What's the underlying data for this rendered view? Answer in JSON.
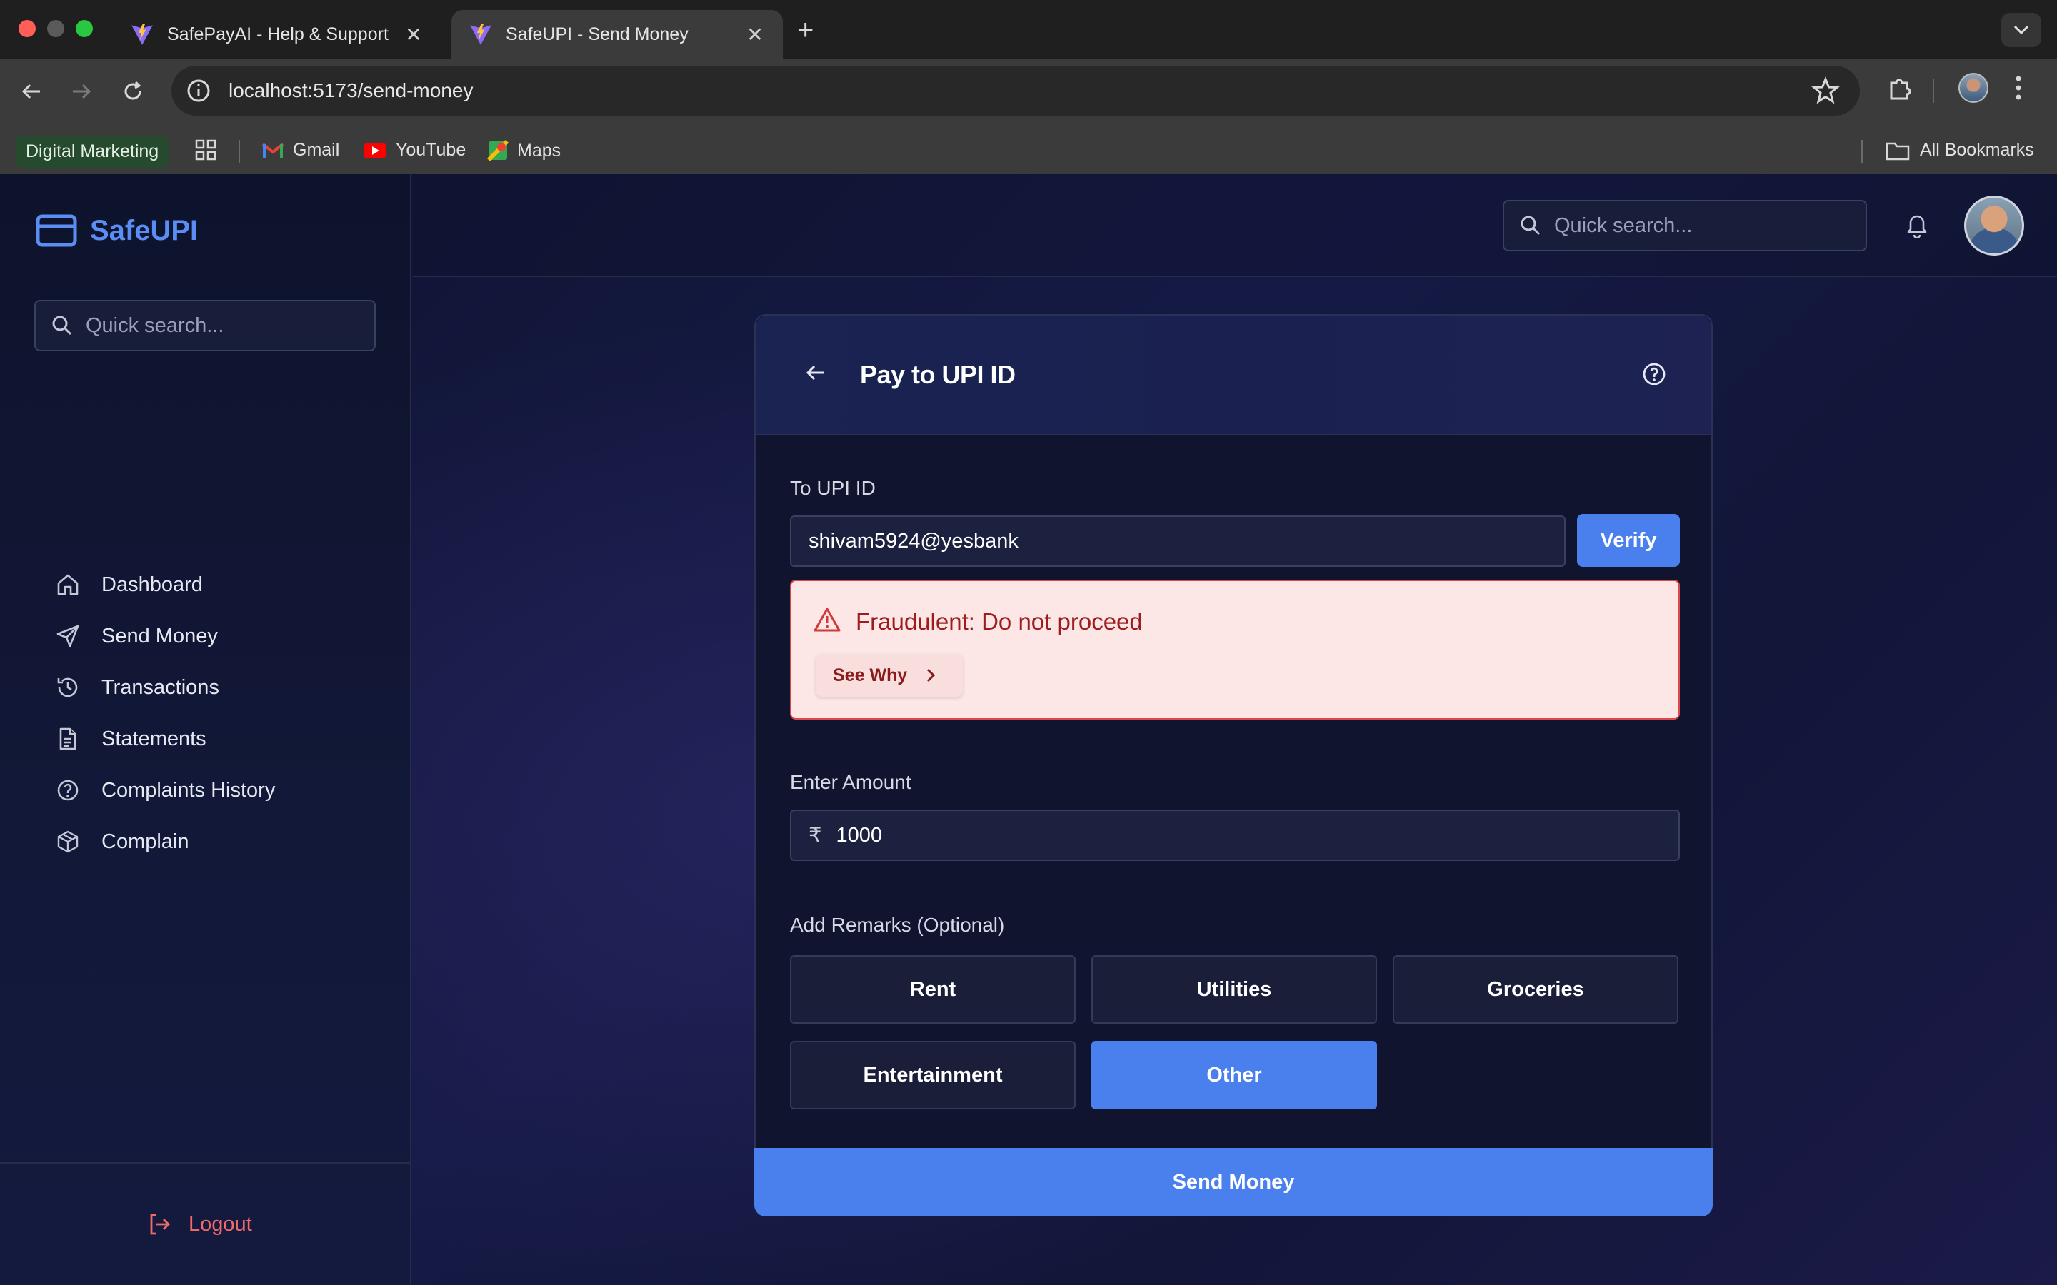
{
  "browser": {
    "tabs": [
      {
        "title": "SafePayAI - Help & Support",
        "active": false
      },
      {
        "title": "SafeUPI - Send Money",
        "active": true
      }
    ],
    "url": "localhost:5173/send-money",
    "bookmarks": {
      "chip": "Digital Marketing",
      "items": [
        "Gmail",
        "YouTube",
        "Maps"
      ],
      "all": "All Bookmarks"
    }
  },
  "sidebar": {
    "brand": "SafeUPI",
    "search_placeholder": "Quick search...",
    "items": [
      {
        "label": "Dashboard",
        "icon": "home-icon"
      },
      {
        "label": "Send Money",
        "icon": "send-icon"
      },
      {
        "label": "Transactions",
        "icon": "history-icon"
      },
      {
        "label": "Statements",
        "icon": "document-icon"
      },
      {
        "label": "Complaints History",
        "icon": "help-circle-icon"
      },
      {
        "label": "Complain",
        "icon": "package-icon"
      }
    ],
    "logout": "Logout"
  },
  "topbar": {
    "search_placeholder": "Quick search..."
  },
  "card": {
    "title": "Pay to UPI ID",
    "upi_label": "To UPI ID",
    "upi_value": "shivam5924@yesbank",
    "verify_label": "Verify",
    "alert_text": "Fraudulent: Do not proceed",
    "see_why_label": "See Why",
    "amount_label": "Enter Amount",
    "currency_symbol": "₹",
    "amount_value": "1000",
    "remarks_label": "Add Remarks (Optional)",
    "remarks": [
      "Rent",
      "Utilities",
      "Groceries",
      "Entertainment",
      "Other"
    ],
    "selected_remark": "Other",
    "send_label": "Send Money"
  },
  "colors": {
    "accent": "#4a80ee",
    "brand": "#5b8ef5",
    "danger_text": "#9e1c1c",
    "danger_bg": "#fce6e6",
    "danger_border": "#e0464a",
    "logout": "#f06a6a"
  }
}
